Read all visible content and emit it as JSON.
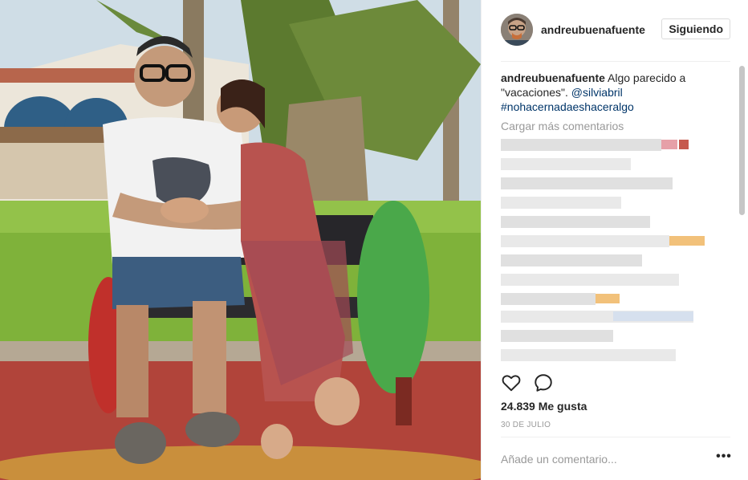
{
  "post": {
    "username": "andreubuenafuente",
    "follow_label": "Siguiendo",
    "caption": {
      "author": "andreubuenafuente",
      "text": " Algo parecido a \"vacaciones\". ",
      "mention": "@silviabril",
      "hashtag": "#nohacernadaeshaceralgo"
    },
    "load_more_label": "Cargar más comentarios",
    "likes_text": "24.839 Me gusta",
    "date_text": "30 DE JULIO",
    "comment_placeholder": "Añade un comentario...",
    "more_options": "•••"
  },
  "icons": {
    "like": "heart-outline-icon",
    "comment": "speech-bubble-icon",
    "options": "more-horizontal-icon"
  },
  "colors": {
    "link": "#003569",
    "muted": "#999999",
    "border": "#dbdbdb"
  }
}
